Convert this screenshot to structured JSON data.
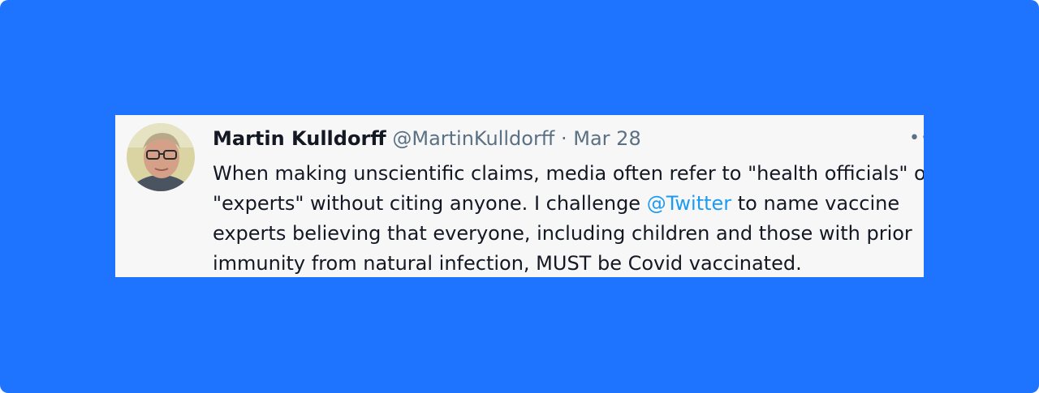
{
  "tweet": {
    "author": {
      "display_name": "Martin Kulldorff",
      "handle": "@MartinKulldorff",
      "avatar_icon": "profile-photo"
    },
    "separator": "·",
    "date": "Mar 28",
    "more_icon": "ellipsis-icon",
    "text": {
      "line1": "When making unscientific claims, media often refer to \"health officials\" or",
      "line2_before": "\"experts\" without citing anyone. I challenge ",
      "mention": "@Twitter",
      "line2_after": " to name vaccine",
      "line3": "experts believing that everyone, including children and those with prior",
      "line4": "immunity from natural infection, MUST be Covid vaccinated."
    }
  },
  "colors": {
    "background": "#1f74ff",
    "card": "#f7f7f8",
    "link": "#1d9bf0",
    "muted": "#5b7083"
  }
}
